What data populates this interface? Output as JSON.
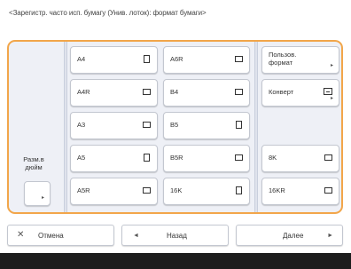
{
  "title": "<Зарегистр. часто исп. бумагу (Унив. лоток): формат бумаги>",
  "sizes": {
    "a4": "A4",
    "a4r": "A4R",
    "a3": "A3",
    "a5": "A5",
    "a5r": "A5R",
    "a6r": "A6R",
    "b4": "B4",
    "b5": "B5",
    "b5r": "B5R",
    "k16": "16K",
    "k8": "8K",
    "k16r": "16KR"
  },
  "custom_size": "Пользов. формат",
  "envelope": "Конверт",
  "side": "Разм.в дюйм",
  "footer": {
    "cancel": "Отмена",
    "back": "Назад",
    "next": "Далее"
  },
  "colors": {
    "accent": "#f2a64a",
    "panel": "#eef0f6",
    "footer_bar": "#1d1d1d"
  }
}
